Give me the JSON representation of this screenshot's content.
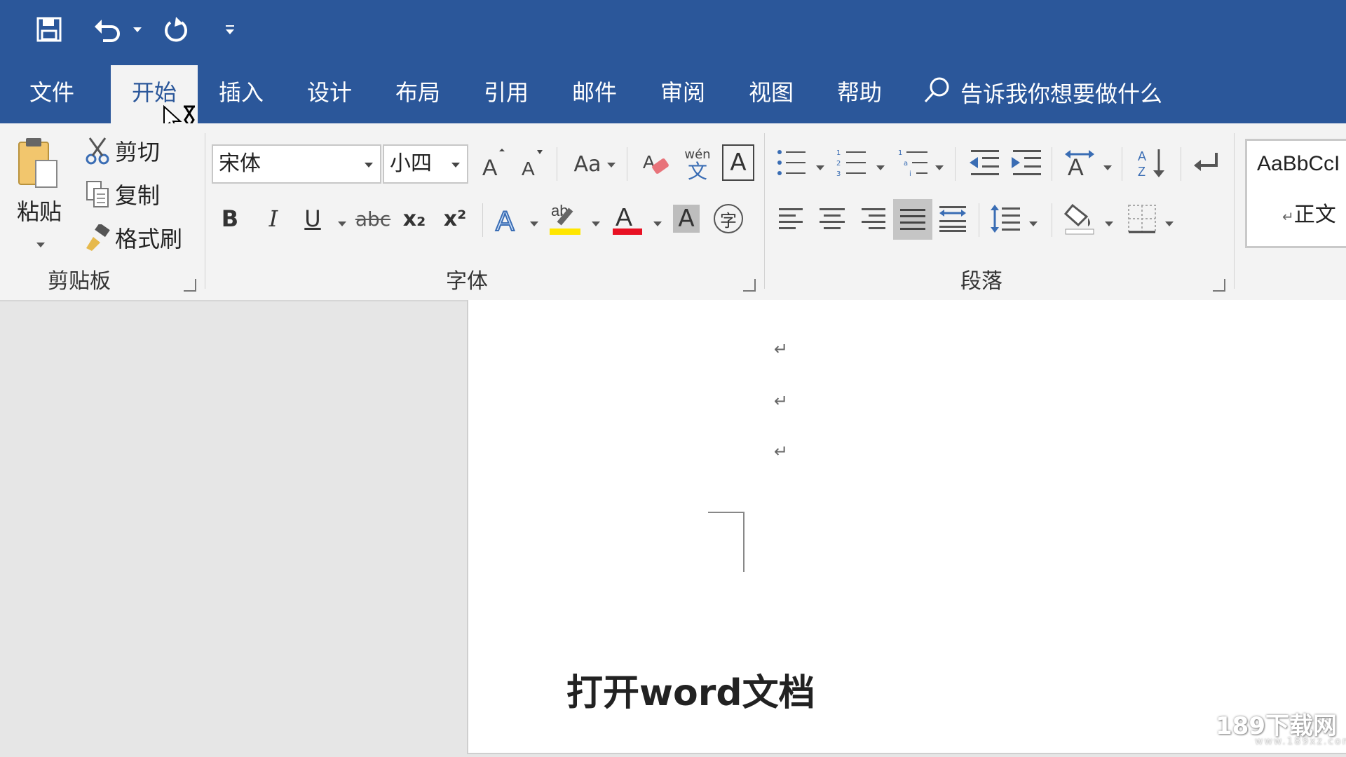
{
  "qat": {
    "save": "save-icon",
    "undo": "undo-icon",
    "redo": "redo-icon",
    "customize": "customize-qat-icon"
  },
  "tabs": [
    "文件",
    "开始",
    "插入",
    "设计",
    "布局",
    "引用",
    "邮件",
    "审阅",
    "视图",
    "帮助"
  ],
  "active_tab": "开始",
  "tell_me": "告诉我你想要做什么",
  "clipboard": {
    "paste": "粘贴",
    "cut": "剪切",
    "copy": "复制",
    "format_painter": "格式刷",
    "group": "剪贴板"
  },
  "font": {
    "name": "宋体",
    "size": "小四",
    "group": "字体",
    "change_case": "Aa",
    "pinyin": "wén",
    "pinyin_char": "文",
    "bold": "B",
    "italic": "I",
    "underline": "U",
    "strike": "abc",
    "subscript": "x₂",
    "superscript": "x²",
    "font_color_letter": "A",
    "shading_letter": "A",
    "enclose": "字",
    "highlight": "ab"
  },
  "paragraph": {
    "group": "段落"
  },
  "styles": {
    "sample": "AaBbCcI",
    "normal": "正文"
  },
  "document": {
    "pilcrow": "↵"
  },
  "caption": "打开word文档",
  "watermark": {
    "main": "189下载网",
    "sub": "www.189xz.com"
  },
  "colors": {
    "accent": "#2b579a",
    "highlight": "#ffe600",
    "font_color": "#e81123"
  }
}
